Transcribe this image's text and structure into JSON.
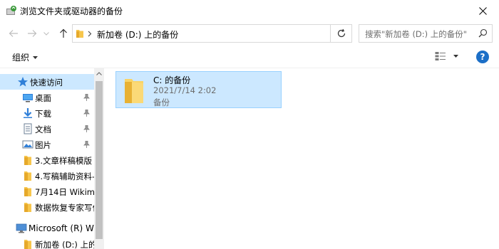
{
  "window": {
    "title": "浏览文件夹或驱动器的备份"
  },
  "address": {
    "crumb": "新加卷 (D:) 上的备份"
  },
  "search": {
    "placeholder": "搜索\"新加卷 (D:) 上的备份\""
  },
  "toolbar": {
    "organize_label": "组织",
    "help_label": "?"
  },
  "sidebar": {
    "items": [
      {
        "label": "快速访问",
        "icon": "star-icon",
        "pinned": false,
        "selected": true
      },
      {
        "label": "桌面",
        "icon": "desktop-icon",
        "pinned": true
      },
      {
        "label": "下载",
        "icon": "download-icon",
        "pinned": true
      },
      {
        "label": "文档",
        "icon": "document-icon",
        "pinned": true
      },
      {
        "label": "图片",
        "icon": "pictures-icon",
        "pinned": true
      },
      {
        "label": "3.文章样稿模版",
        "icon": "folder-icon",
        "pinned": false
      },
      {
        "label": "4.写稿辅助资料-",
        "icon": "folder-icon",
        "pinned": false
      },
      {
        "label": "7月14日 Wikim",
        "icon": "folder-icon",
        "pinned": false
      },
      {
        "label": "数据恢复专家写作",
        "icon": "folder-icon",
        "pinned": false
      },
      {
        "label": "Microsoft (R) Wi",
        "icon": "computer-icon",
        "pinned": false
      },
      {
        "label": "新加卷 (D:) 上的",
        "icon": "folder-icon",
        "pinned": false
      }
    ]
  },
  "content": {
    "items": [
      {
        "name": "C: 的备份",
        "date": "2021/7/14 2:02",
        "description": "备份"
      }
    ]
  },
  "colors": {
    "selection": "#cce8ff",
    "selection_border": "#99d1ff",
    "folder": "#f7c64c",
    "accent": "#1c6fc7"
  }
}
